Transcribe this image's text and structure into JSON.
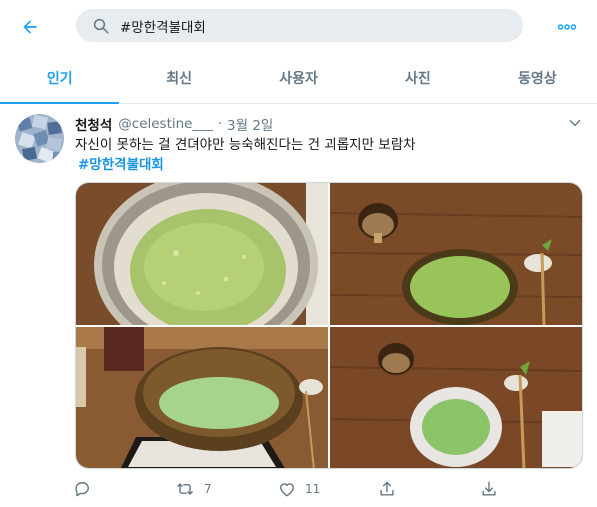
{
  "header": {
    "back_icon": "arrow-left-icon",
    "search": {
      "value": "#망한격불대회",
      "icon": "search-icon"
    },
    "more_icon": "more-horizontal-icon"
  },
  "tabs": [
    {
      "label": "인기",
      "active": true
    },
    {
      "label": "최신",
      "active": false
    },
    {
      "label": "사용자",
      "active": false
    },
    {
      "label": "사진",
      "active": false
    },
    {
      "label": "동영상",
      "active": false
    }
  ],
  "tweet": {
    "display_name": "천청석",
    "handle": "@celestine___",
    "separator": "·",
    "time": "3월 2일",
    "text": "자신이 못하는 걸 견뎌야만 능숙해진다는 건 괴롭지만 보람차",
    "hashtag": "#망한격불대회",
    "actions": {
      "reply": {
        "icon": "reply-icon",
        "count": ""
      },
      "retweet": {
        "icon": "retweet-icon",
        "count": "7"
      },
      "like": {
        "icon": "heart-icon",
        "count": "11"
      },
      "share": {
        "icon": "share-icon",
        "count": ""
      },
      "download": {
        "icon": "download-icon",
        "count": ""
      }
    }
  },
  "colors": {
    "accent": "#1da1f2",
    "text": "#14171a",
    "muted": "#657786",
    "search_bg": "#e6ecf0",
    "border": "#e6ecf0",
    "matcha": "#8cc46a",
    "wood": "#7a4a28"
  }
}
